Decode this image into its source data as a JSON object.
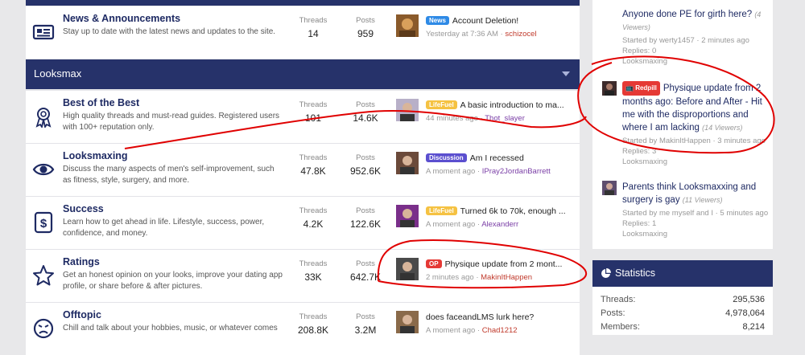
{
  "forum": {
    "announcement": {
      "title": "News & Announcements",
      "desc": "Stay up to date with the latest news and updates to the site.",
      "threads_label": "Threads",
      "threads": "14",
      "posts_label": "Posts",
      "posts": "959",
      "latest": {
        "badge": "News",
        "title": "Account Deletion!",
        "time": "Yesterday at 7:36 AM",
        "user": "schizocel"
      }
    },
    "section_title": "Looksmax",
    "nodes": [
      {
        "title": "Best of the Best",
        "desc": "High quality threads and must-read guides. Registered users with 100+ reputation only.",
        "threads_label": "Threads",
        "threads": "101",
        "posts_label": "Posts",
        "posts": "14.6K",
        "badge": "LifeFuel",
        "latest_title": "A basic introduction to ma...",
        "time": "44 minutes ago",
        "user": "Thot_slayer",
        "icon": "award-ribbon-icon"
      },
      {
        "title": "Looksmaxing",
        "desc": "Discuss the many aspects of men's self-improvement, such as fitness, style, surgery, and more.",
        "threads_label": "Threads",
        "threads": "47.8K",
        "posts_label": "Posts",
        "posts": "952.6K",
        "badge": "Discussion",
        "latest_title": "Am I recessed",
        "time": "A moment ago",
        "user": "IPray2JordanBarrett",
        "icon": "eye-icon"
      },
      {
        "title": "Success",
        "desc": "Learn how to get ahead in life. Lifestyle, success, power, confidence, and money.",
        "threads_label": "Threads",
        "threads": "4.2K",
        "posts_label": "Posts",
        "posts": "122.6K",
        "badge": "LifeFuel",
        "latest_title": "Turned 6k to 70k, enough ...",
        "time": "A moment ago",
        "user": "Alexanderr",
        "icon": "dollar-icon"
      },
      {
        "title": "Ratings",
        "desc": "Get an honest opinion on your looks, improve your dating app profile, or share before & after pictures.",
        "threads_label": "Threads",
        "threads": "33K",
        "posts_label": "Posts",
        "posts": "642.7K",
        "badge": "OP",
        "latest_title": "Physique update from 2 mont...",
        "time": "2 minutes ago",
        "user": "MakinItHappen",
        "icon": "star-icon"
      },
      {
        "title": "Offtopic",
        "desc": "Chill and talk about your hobbies, music, or whatever comes",
        "threads_label": "Threads",
        "threads": "208.8K",
        "posts_label": "Posts",
        "posts": "3.2M",
        "badge": "",
        "latest_title": "does faceandLMS lurk here?",
        "time": "A moment ago",
        "user": "Chad1212",
        "icon": "angry-face-icon"
      }
    ]
  },
  "sidebar": {
    "threads": [
      {
        "title": "Anyone done PE for girth here?",
        "views": "(4 Viewers)",
        "meta": "Started by werty1457 · 2 minutes ago",
        "replies": "Replies: 0",
        "forum": "Looksmaxing"
      },
      {
        "badge": "Redpill",
        "title": "Physique update from 2 months ago: Before and After - Hit me with the disproportions and where I am lacking",
        "views": "(14 Viewers)",
        "meta": "Started by MakinItHappen · 3 minutes ago",
        "replies": "Replies: 3",
        "forum": "Looksmaxing"
      },
      {
        "title": "Parents think Looksmaxxing and surgery is gay",
        "views": "(11 Viewers)",
        "meta": "Started by me myself and I · 5 minutes ago",
        "replies": "Replies: 1",
        "forum": "Looksmaxing"
      }
    ],
    "statistics": {
      "title": "Statistics",
      "rows": [
        {
          "k": "Threads:",
          "v": "295,536"
        },
        {
          "k": "Posts:",
          "v": "4,978,064"
        },
        {
          "k": "Members:",
          "v": "8,214"
        }
      ]
    }
  },
  "colors": {
    "navy": "#26326a",
    "annotation": "#e00000"
  }
}
